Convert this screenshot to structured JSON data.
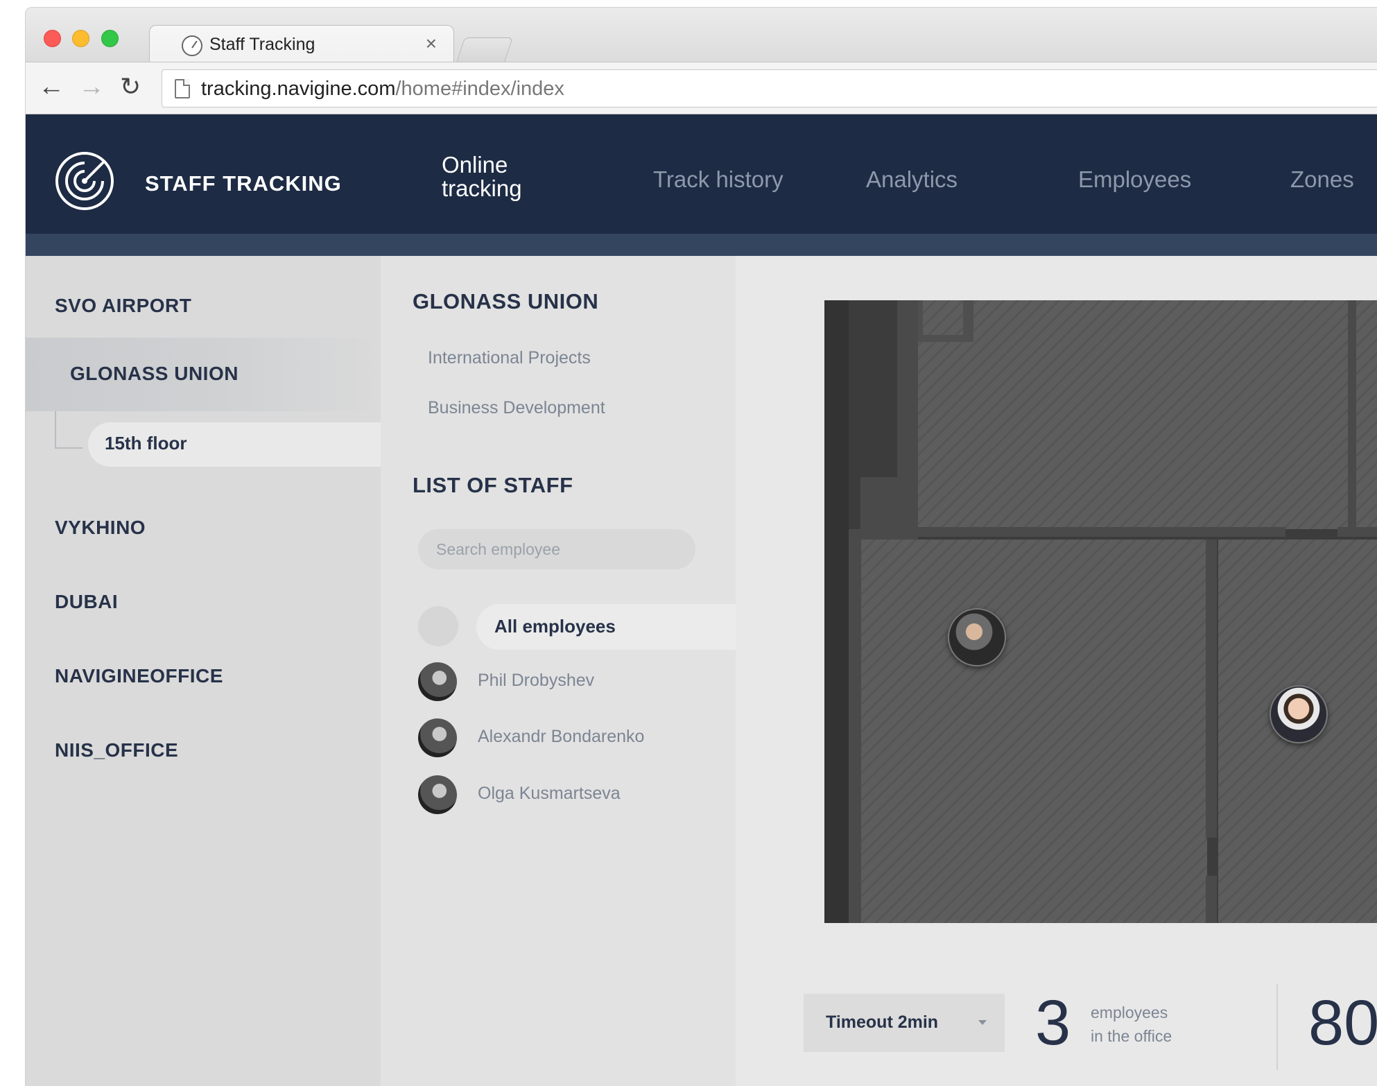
{
  "browser": {
    "tab_title": "Staff Tracking",
    "tab_close": "×",
    "url_host": "tracking.navigine.com",
    "url_path": "/home#index/index",
    "back_glyph": "←",
    "forward_glyph": "→",
    "reload_glyph": "↻"
  },
  "header": {
    "brand": "STAFF TRACKING",
    "logo_icon": "radar-icon",
    "nav": [
      {
        "line1": "Online",
        "line2": "tracking",
        "active": true
      },
      {
        "label": "Track history",
        "active": false
      },
      {
        "label": "Analytics",
        "active": false
      },
      {
        "label": "Employees",
        "active": false
      },
      {
        "label": "Zones",
        "active": false
      }
    ],
    "bg_color": "#1d2b44",
    "sub_bar_color": "#33455f"
  },
  "sidebar": {
    "locations": [
      {
        "label": "SVO AIRPORT"
      },
      {
        "label": "GLONASS UNION",
        "selected": true,
        "floor": "15th floor"
      },
      {
        "label": "VYKHINO"
      },
      {
        "label": "DUBAI"
      },
      {
        "label": "NAVIGINEOFFICE"
      },
      {
        "label": "NIIS_OFFICE"
      }
    ]
  },
  "panel": {
    "building_title": "GLONASS UNION",
    "departments": [
      "International Projects",
      "Business Development"
    ],
    "staff_title": "LIST OF STAFF",
    "search_placeholder": "Search employee",
    "all_employees_label": "All employees",
    "employees": [
      {
        "name": "Phil Drobyshev"
      },
      {
        "name": "Alexandr Bondarenko"
      },
      {
        "name": "Olga Kusmartseva"
      }
    ]
  },
  "stats": {
    "timeout_label": "Timeout 2min",
    "employees_in_office": "3",
    "employees_caption_line1": "employees",
    "employees_caption_line2": "in the office",
    "second_value": "80"
  }
}
